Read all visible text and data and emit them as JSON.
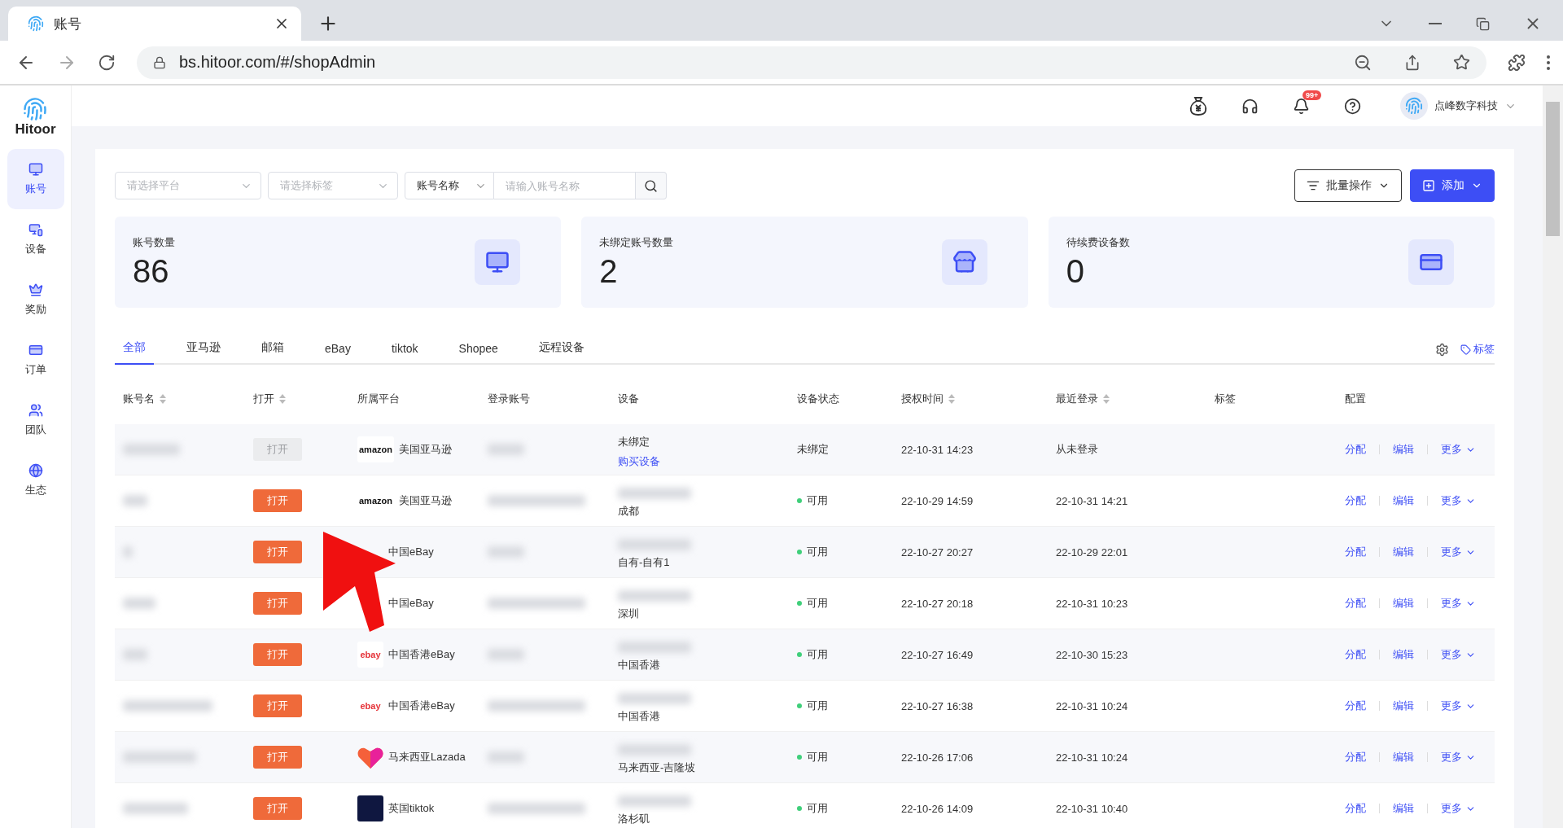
{
  "browser": {
    "tab_title": "账号",
    "url": "bs.hitoor.com/#/shopAdmin"
  },
  "sidebar": {
    "brand": "Hitoor",
    "items": [
      {
        "label": "账号",
        "selected": true
      },
      {
        "label": "设备",
        "selected": false
      },
      {
        "label": "奖励",
        "selected": false
      },
      {
        "label": "订单",
        "selected": false
      },
      {
        "label": "团队",
        "selected": false
      },
      {
        "label": "生态",
        "selected": false
      }
    ]
  },
  "header": {
    "notification_badge": "99+",
    "user": "点峰数字科技"
  },
  "filters": {
    "platform_placeholder": "请选择平台",
    "tag_placeholder": "请选择标签",
    "search_field": "账号名称",
    "search_placeholder": "请输入账号名称"
  },
  "actions": [
    {
      "label": "批量操作",
      "kind": "outline"
    },
    {
      "label": "添加",
      "kind": "primary"
    }
  ],
  "stats": [
    {
      "label": "账号数量",
      "value": "86"
    },
    {
      "label": "未绑定账号数量",
      "value": "2"
    },
    {
      "label": "待续费设备数",
      "value": "0"
    }
  ],
  "tabs": [
    {
      "label": "全部",
      "selected": true
    },
    {
      "label": "亚马逊",
      "selected": false
    },
    {
      "label": "邮箱",
      "selected": false
    },
    {
      "label": "eBay",
      "selected": false
    },
    {
      "label": "tiktok",
      "selected": false
    },
    {
      "label": "Shopee",
      "selected": false
    },
    {
      "label": "远程设备",
      "selected": false
    }
  ],
  "tag_link": "标签",
  "table": {
    "columns": [
      {
        "label": "账号名",
        "sortable": true
      },
      {
        "label": "打开",
        "sortable": true
      },
      {
        "label": "所属平台",
        "sortable": false
      },
      {
        "label": "登录账号",
        "sortable": false
      },
      {
        "label": "设备",
        "sortable": false
      },
      {
        "label": "设备状态",
        "sortable": false
      },
      {
        "label": "授权时间",
        "sortable": true
      },
      {
        "label": "最近登录",
        "sortable": true
      },
      {
        "label": "标签",
        "sortable": false
      },
      {
        "label": "配置",
        "sortable": false
      }
    ],
    "rows": [
      {
        "open": {
          "label": "打开",
          "disabled": true
        },
        "platform": {
          "kind": "text",
          "logo_text": "amazon",
          "name": "美国亚马逊"
        },
        "device": {
          "bound": false,
          "name": "未绑定",
          "link": "购买设备"
        },
        "status": {
          "label": "未绑定",
          "dot": false
        },
        "auth_time": "22-10-31 14:23",
        "last_login": "从未登录",
        "actions": [
          "分配",
          "编辑",
          "更多"
        ]
      },
      {
        "open": {
          "label": "打开",
          "disabled": false
        },
        "platform": {
          "kind": "text",
          "logo_text": "amazon",
          "name": "美国亚马逊"
        },
        "device": {
          "bound": true,
          "name": "成都"
        },
        "status": {
          "label": "可用",
          "dot": true
        },
        "auth_time": "22-10-29 14:59",
        "last_login": "22-10-31 14:21",
        "actions": [
          "分配",
          "编辑",
          "更多"
        ]
      },
      {
        "open": {
          "label": "打开",
          "disabled": false
        },
        "platform": {
          "kind": "hidden",
          "name": "中国eBay"
        },
        "device": {
          "bound": true,
          "name": "自有-自有1"
        },
        "status": {
          "label": "可用",
          "dot": true
        },
        "auth_time": "22-10-27 20:27",
        "last_login": "22-10-29 22:01",
        "actions": [
          "分配",
          "编辑",
          "更多"
        ]
      },
      {
        "open": {
          "label": "打开",
          "disabled": false
        },
        "platform": {
          "kind": "hidden",
          "name": "中国eBay"
        },
        "device": {
          "bound": true,
          "name": "深圳"
        },
        "status": {
          "label": "可用",
          "dot": true
        },
        "auth_time": "22-10-27 20:18",
        "last_login": "22-10-31 10:23",
        "actions": [
          "分配",
          "编辑",
          "更多"
        ]
      },
      {
        "open": {
          "label": "打开",
          "disabled": false
        },
        "platform": {
          "kind": "text",
          "logo_text": "ebay",
          "name": "中国香港eBay"
        },
        "device": {
          "bound": true,
          "name": "中国香港"
        },
        "status": {
          "label": "可用",
          "dot": true
        },
        "auth_time": "22-10-27 16:49",
        "last_login": "22-10-30 15:23",
        "actions": [
          "分配",
          "编辑",
          "更多"
        ]
      },
      {
        "open": {
          "label": "打开",
          "disabled": false
        },
        "platform": {
          "kind": "text",
          "logo_text": "ebay",
          "name": "中国香港eBay"
        },
        "device": {
          "bound": true,
          "name": "中国香港"
        },
        "status": {
          "label": "可用",
          "dot": true
        },
        "auth_time": "22-10-27 16:38",
        "last_login": "22-10-31 10:24",
        "actions": [
          "分配",
          "编辑",
          "更多"
        ]
      },
      {
        "open": {
          "label": "打开",
          "disabled": false
        },
        "platform": {
          "kind": "heart",
          "name": "马来西亚Lazada"
        },
        "device": {
          "bound": true,
          "name": "马来西亚-吉隆坡"
        },
        "status": {
          "label": "可用",
          "dot": true
        },
        "auth_time": "22-10-26 17:06",
        "last_login": "22-10-31 10:24",
        "actions": [
          "分配",
          "编辑",
          "更多"
        ]
      },
      {
        "open": {
          "label": "打开",
          "disabled": false
        },
        "platform": {
          "kind": "dark",
          "name": "英国tiktok"
        },
        "device": {
          "bound": true,
          "name": "洛杉矶"
        },
        "status": {
          "label": "可用",
          "dot": true
        },
        "auth_time": "22-10-26 14:09",
        "last_login": "22-10-31 10:40",
        "actions": [
          "分配",
          "编辑",
          "更多"
        ]
      }
    ]
  },
  "annotation": {
    "kind": "arrow"
  }
}
